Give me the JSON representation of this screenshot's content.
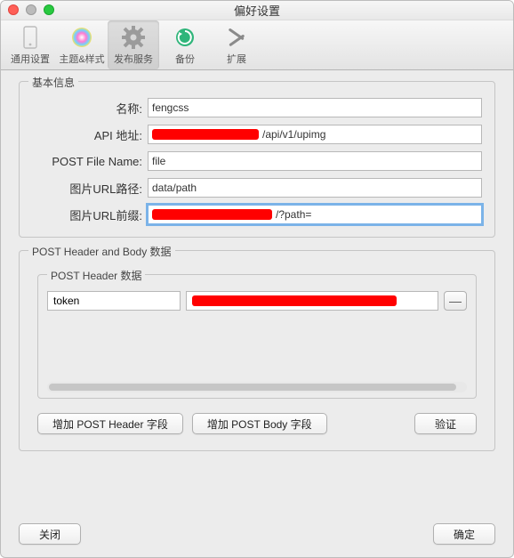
{
  "window": {
    "title": "偏好设置"
  },
  "toolbar": {
    "items": [
      {
        "label": "通用设置"
      },
      {
        "label": "主题&样式"
      },
      {
        "label": "发布服务"
      },
      {
        "label": "备份"
      },
      {
        "label": "扩展"
      }
    ]
  },
  "basic": {
    "title": "基本信息",
    "name_label": "名称:",
    "name_value": "fengcss",
    "api_label": "API 地址:",
    "api_value_suffix": "/api/v1/upimg",
    "post_file_label": "POST File Name:",
    "post_file_value": "file",
    "url_path_label": "图片URL路径:",
    "url_path_value": "data/path",
    "url_prefix_label": "图片URL前缀:",
    "url_prefix_value_suffix": "/?path="
  },
  "headerbody": {
    "title": "POST Header and Body 数据",
    "inner_title": "POST Header 数据",
    "rows": [
      {
        "key": "token",
        "value": ""
      }
    ]
  },
  "buttons": {
    "add_header": "增加 POST Header 字段",
    "add_body": "增加 POST Body 字段",
    "verify": "验证",
    "close": "关闭",
    "ok": "确定",
    "minus": "—"
  }
}
